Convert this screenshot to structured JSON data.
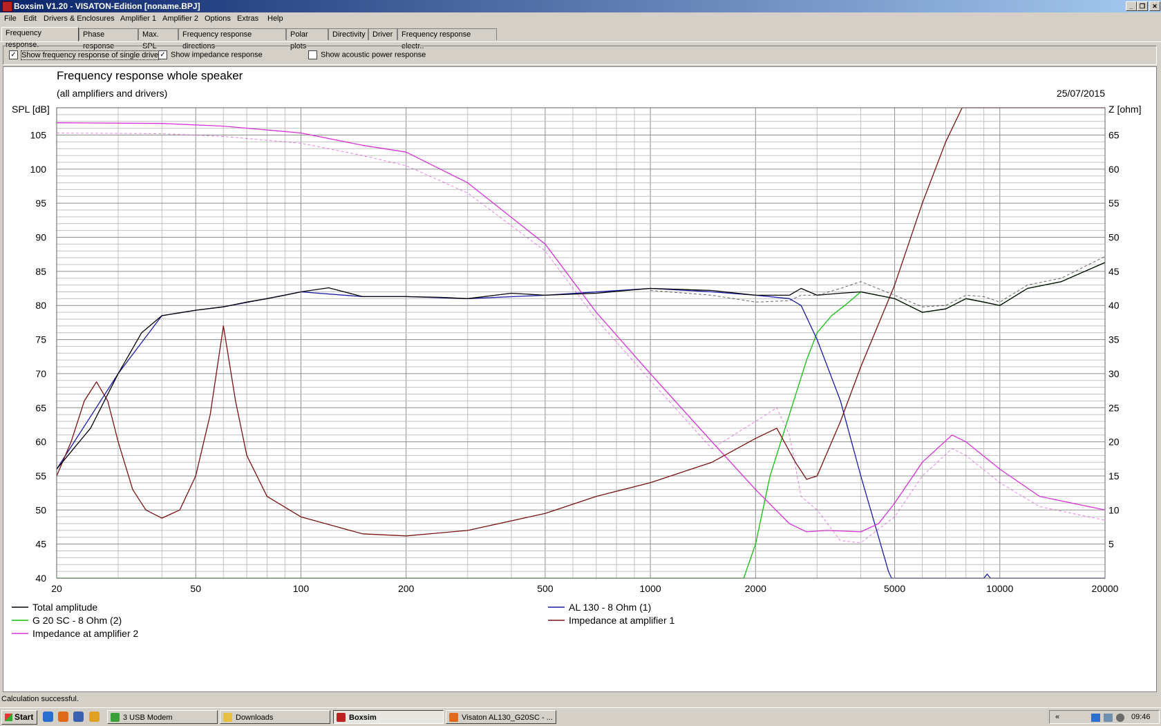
{
  "window": {
    "title": "Boxsim V1.20 - VISATON-Edition [noname.BPJ]"
  },
  "menu": [
    "File",
    "Edit",
    "Drivers & Enclosures",
    "Amplifier 1",
    "Amplifier 2",
    "Options",
    "Extras",
    "Help"
  ],
  "tabs": [
    "Frequency response.",
    "Phase response",
    "Max. SPL",
    "Frequency response directions",
    "Polar plots",
    "Directivity",
    "Driver",
    "Frequency response electr.."
  ],
  "options": {
    "single_driver": {
      "label": "Show frequency response of single drive",
      "checked": true
    },
    "impedance": {
      "label": "Show impedance response",
      "checked": true
    },
    "acoustic_power": {
      "label": "Show acoustic power response",
      "checked": false
    }
  },
  "status": {
    "text": "Calculation successful."
  },
  "taskbar": {
    "start": "Start",
    "tasks": [
      "3 USB Modem",
      "Downloads",
      "Boxsim",
      "Visaton AL130_G20SC - ..."
    ],
    "tray_arrow": "«",
    "clock": "09:46"
  },
  "colors": {
    "total": "#000000",
    "al130": "#1a1aa8",
    "g20": "#10c010",
    "imp1": "#7a1010",
    "imp2": "#d830d8",
    "grid_major": "#8c8c8c",
    "grid_minor": "#c0c0c0"
  },
  "chart_data": {
    "type": "line",
    "title": "Frequency response whole speaker",
    "subtitle": "(all amplifiers and drivers)",
    "date": "25/07/2015",
    "ylabel": "SPL [dB]",
    "y2label": "Z [ohm]",
    "xscale": "log",
    "xlim": [
      20,
      20000
    ],
    "ylim": [
      40,
      109
    ],
    "y2lim": [
      0,
      69
    ],
    "grid": true,
    "xticks": [
      20,
      50,
      100,
      200,
      500,
      1000,
      2000,
      5000,
      10000,
      20000
    ],
    "xtick_labels": [
      "20",
      "50",
      "100",
      "200",
      "500",
      "1000",
      "2000",
      "5000",
      "10000",
      "20000"
    ],
    "yticks": [
      40,
      45,
      50,
      55,
      60,
      65,
      70,
      75,
      80,
      85,
      90,
      95,
      100,
      105
    ],
    "y2ticks": [
      5,
      10,
      15,
      20,
      25,
      30,
      35,
      40,
      45,
      50,
      55,
      60,
      65
    ],
    "legend": [
      {
        "label": "Total amplitude",
        "series": "total"
      },
      {
        "label": "AL 130 - 8 Ohm (1)",
        "series": "al130"
      },
      {
        "label": "G 20 SC - 8 Ohm (2)",
        "series": "g20"
      },
      {
        "label": "Impedance at amplifier 1",
        "series": "imp1"
      },
      {
        "label": "Impedance at amplifier 2",
        "series": "imp2"
      }
    ],
    "series": [
      {
        "id": "total",
        "name": "Total amplitude",
        "axis": "left",
        "x": [
          20,
          25,
          30,
          35,
          40,
          50,
          60,
          70,
          80,
          90,
          100,
          120,
          150,
          200,
          250,
          300,
          400,
          500,
          700,
          1000,
          1500,
          2000,
          2500,
          2700,
          3000,
          3500,
          4000,
          5000,
          6000,
          7000,
          8000,
          9000,
          10000,
          12000,
          15000,
          20000
        ],
        "y": [
          56,
          62,
          70,
          76,
          78.5,
          79.3,
          79.8,
          80.5,
          81,
          81.5,
          82,
          82.6,
          81.3,
          81.3,
          81.2,
          81,
          81.8,
          81.5,
          81.8,
          82.5,
          82.2,
          81.5,
          81.5,
          82.5,
          81.5,
          81.8,
          82,
          81,
          79,
          79.5,
          81,
          80.5,
          80,
          82.5,
          83.5,
          86.3
        ]
      },
      {
        "id": "total_dashed",
        "name": "",
        "axis": "left",
        "dashed": true,
        "x": [
          1000,
          1500,
          2000,
          2500,
          2700,
          3000,
          3500,
          4000,
          5000,
          6000,
          7000,
          8000,
          9000,
          10000,
          12000,
          15000,
          20000
        ],
        "y": [
          82.2,
          81.5,
          80.5,
          80.7,
          81.5,
          81.5,
          82.5,
          83.5,
          81.5,
          79.8,
          80,
          81.5,
          81.3,
          80.5,
          83,
          84,
          87.2
        ]
      },
      {
        "id": "al130",
        "name": "AL 130 - 8 Ohm (1)",
        "axis": "left",
        "x": [
          20,
          30,
          40,
          50,
          60,
          80,
          100,
          150,
          200,
          300,
          500,
          1000,
          1500,
          2000,
          2500,
          2700,
          3000,
          3500,
          4000,
          4500,
          4800,
          4900,
          5000,
          7000,
          9000,
          9200,
          9400,
          10000,
          20000
        ],
        "y": [
          56,
          70,
          78.5,
          79.3,
          79.8,
          81,
          82,
          81.3,
          81.3,
          81,
          81.5,
          82.5,
          82,
          81.5,
          81,
          80,
          75,
          66,
          55,
          46,
          41,
          40,
          40,
          40,
          40,
          40.6,
          40,
          40,
          40
        ]
      },
      {
        "id": "g20",
        "name": "G 20 SC - 8 Ohm (2)",
        "axis": "left",
        "x": [
          20,
          1700,
          1850,
          2000,
          2200,
          2500,
          2800,
          3000,
          3300,
          3600,
          4000,
          5000,
          6000,
          7000,
          8000,
          9000,
          10000,
          12000,
          15000,
          20000
        ],
        "y": [
          40,
          40,
          40,
          45,
          55,
          64,
          72,
          76,
          78.5,
          80,
          82,
          81,
          79,
          79.5,
          81,
          80.5,
          80,
          82.5,
          83.5,
          86.3
        ]
      },
      {
        "id": "imp1",
        "name": "Impedance at amplifier 1",
        "axis": "right",
        "x": [
          20,
          22,
          24,
          26,
          28,
          30,
          33,
          36,
          40,
          45,
          50,
          55,
          60,
          65,
          70,
          80,
          100,
          150,
          200,
          300,
          500,
          700,
          1000,
          1500,
          2000,
          2300,
          2600,
          2800,
          3000,
          3500,
          4000,
          5000,
          6000,
          7000,
          7800,
          20000
        ],
        "y": [
          15,
          20,
          26,
          28.8,
          26,
          20,
          13,
          10,
          8.8,
          10,
          15,
          24,
          37,
          26,
          18,
          12,
          9,
          6.5,
          6.2,
          7,
          9.5,
          12,
          14,
          17,
          20.5,
          22,
          17,
          14.5,
          15,
          23,
          31,
          43,
          55,
          64,
          69,
          69
        ]
      },
      {
        "id": "imp2",
        "name": "Impedance at amplifier 2",
        "axis": "right",
        "x": [
          20,
          40,
          60,
          100,
          150,
          200,
          300,
          500,
          700,
          1000,
          1500,
          2000,
          2500,
          2800,
          3200,
          4000,
          4500,
          5000,
          6000,
          7300,
          8000,
          10000,
          13000,
          20000
        ],
        "y": [
          66.8,
          66.7,
          66.3,
          65.3,
          63.5,
          62.5,
          58,
          49,
          39,
          30,
          20,
          13,
          8,
          6.8,
          7,
          6.8,
          8,
          11,
          17,
          21,
          20,
          16,
          12,
          10
        ]
      },
      {
        "id": "imp2_dashed",
        "name": "",
        "axis": "right",
        "dashed": true,
        "x": [
          20,
          40,
          60,
          100,
          150,
          200,
          300,
          500,
          700,
          1000,
          1500,
          2000,
          2300,
          2500,
          2700,
          3000,
          3500,
          4000,
          5000,
          6000,
          7300,
          8000,
          10000,
          13000,
          20000
        ],
        "y": [
          65.3,
          65.2,
          64.8,
          63.8,
          62,
          60.5,
          56.5,
          48,
          38,
          29,
          19,
          23,
          25,
          21,
          12,
          10,
          5.5,
          5.2,
          9,
          15,
          19,
          18,
          14,
          10.5,
          8.5
        ]
      }
    ]
  }
}
